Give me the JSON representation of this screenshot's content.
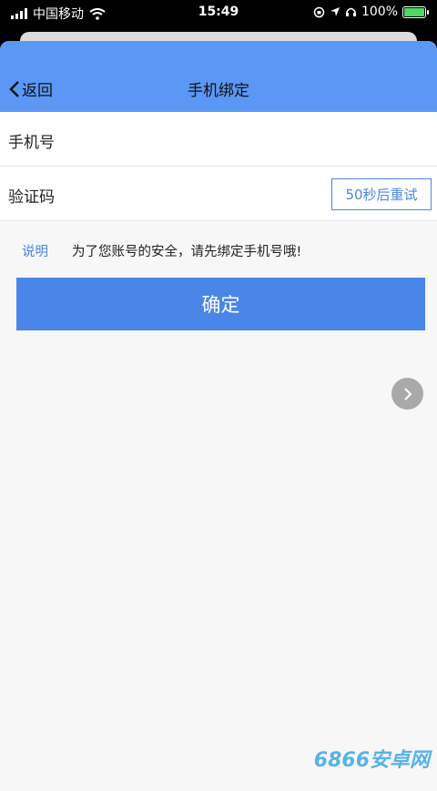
{
  "status_bar": {
    "carrier": "中国移动",
    "time": "15:49",
    "battery": "100%"
  },
  "nav": {
    "back_label": "返回",
    "title": "手机绑定"
  },
  "form": {
    "phone_label": "手机号",
    "phone_value": "",
    "code_label": "验证码",
    "code_value": "",
    "resend_label": "50秒后重试"
  },
  "note": {
    "tag": "说明",
    "text": "为了您账号的安全，请先绑定手机号哦!"
  },
  "confirm_label": "确定",
  "watermark": "6866安卓网",
  "colors": {
    "nav_bg": "#5b97f5",
    "accent": "#4a86e8",
    "page_bg": "#f7f7f7"
  },
  "icons": [
    "signal-icon",
    "wifi-icon",
    "location-icon",
    "headphones-icon",
    "battery-icon",
    "chevron-left-icon",
    "chevron-right-icon"
  ]
}
